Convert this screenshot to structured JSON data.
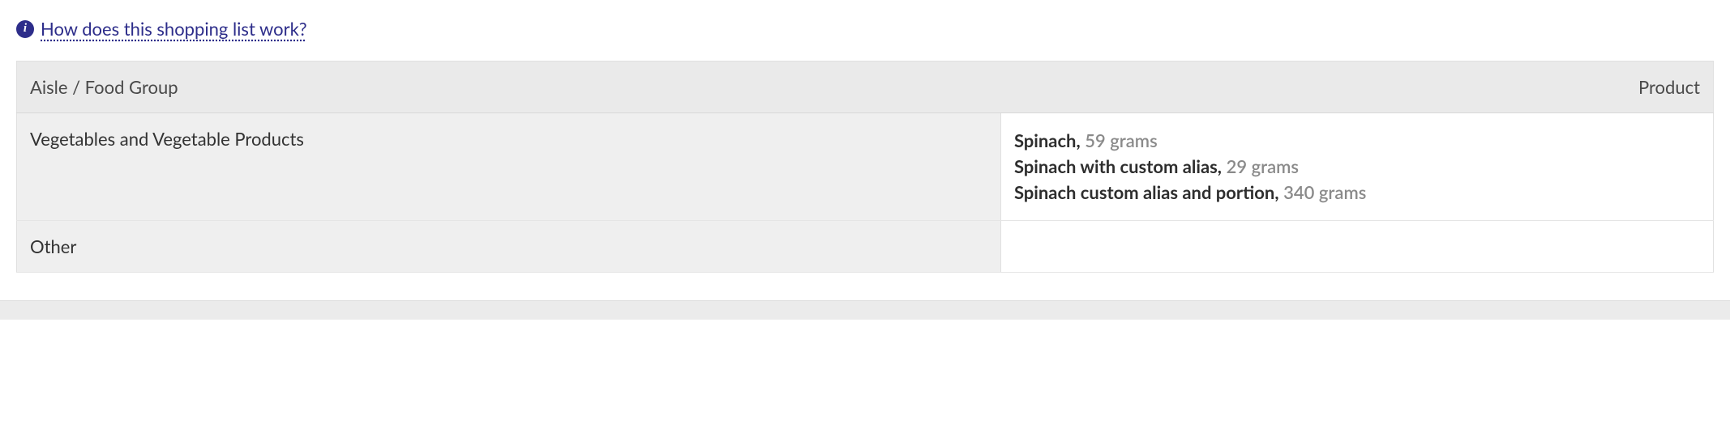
{
  "help": {
    "label": "How does this shopping list work?"
  },
  "table": {
    "headers": {
      "aisle": "Aisle / Food Group",
      "product": "Product"
    },
    "rows": [
      {
        "aisle": "Vegetables and Vegetable Products",
        "products": [
          {
            "name": "Spinach,",
            "amount": "59 grams"
          },
          {
            "name": "Spinach with custom alias,",
            "amount": "29 grams"
          },
          {
            "name": "Spinach custom alias and portion,",
            "amount": "340 grams"
          }
        ]
      },
      {
        "aisle": "Other",
        "products": []
      }
    ]
  }
}
